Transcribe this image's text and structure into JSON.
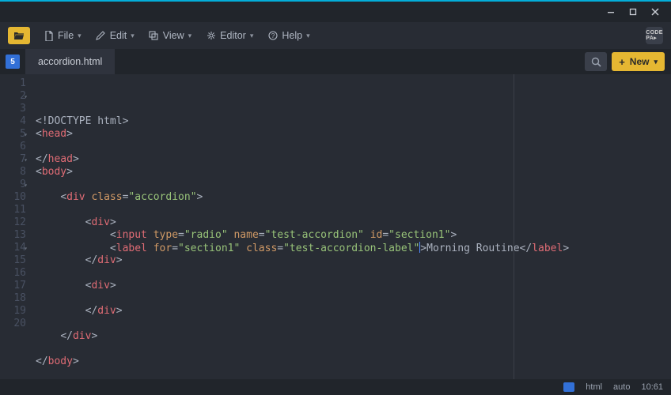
{
  "menu": {
    "file": "File",
    "edit": "Edit",
    "view": "View",
    "editor": "Editor",
    "help": "Help"
  },
  "tabs": {
    "active": "accordion.html",
    "new_label": "New"
  },
  "editor": {
    "lines": [
      {
        "n": 1,
        "fold": false,
        "tokens": [
          [
            "<!DOCTYPE html>",
            "t-doc"
          ]
        ]
      },
      {
        "n": 2,
        "fold": true,
        "tokens": [
          [
            "<",
            "t-punc"
          ],
          [
            "head",
            "t-tag"
          ],
          [
            ">",
            "t-punc"
          ]
        ]
      },
      {
        "n": 3,
        "fold": false,
        "tokens": []
      },
      {
        "n": 4,
        "fold": false,
        "tokens": [
          [
            "</",
            "t-punc"
          ],
          [
            "head",
            "t-tag"
          ],
          [
            ">",
            "t-punc"
          ]
        ]
      },
      {
        "n": 5,
        "fold": true,
        "tokens": [
          [
            "<",
            "t-punc"
          ],
          [
            "body",
            "t-tag"
          ],
          [
            ">",
            "t-punc"
          ]
        ]
      },
      {
        "n": 6,
        "fold": false,
        "tokens": []
      },
      {
        "n": 7,
        "fold": true,
        "tokens": [
          [
            "    ",
            "t-punc"
          ],
          [
            "<",
            "t-punc"
          ],
          [
            "div",
            "t-tag"
          ],
          [
            " ",
            "t-punc"
          ],
          [
            "class",
            "t-attr"
          ],
          [
            "=",
            "t-punc"
          ],
          [
            "\"accordion\"",
            "t-str"
          ],
          [
            ">",
            "t-punc"
          ]
        ]
      },
      {
        "n": 8,
        "fold": false,
        "tokens": []
      },
      {
        "n": 9,
        "fold": true,
        "tokens": [
          [
            "        ",
            "t-punc"
          ],
          [
            "<",
            "t-punc"
          ],
          [
            "div",
            "t-tag"
          ],
          [
            ">",
            "t-punc"
          ]
        ]
      },
      {
        "n": 10,
        "fold": false,
        "tokens": [
          [
            "            ",
            "t-punc"
          ],
          [
            "<",
            "t-punc"
          ],
          [
            "input",
            "t-tag"
          ],
          [
            " ",
            "t-punc"
          ],
          [
            "type",
            "t-attr"
          ],
          [
            "=",
            "t-punc"
          ],
          [
            "\"radio\"",
            "t-str"
          ],
          [
            " ",
            "t-punc"
          ],
          [
            "name",
            "t-attr"
          ],
          [
            "=",
            "t-punc"
          ],
          [
            "\"test-accordion\"",
            "t-str"
          ],
          [
            " ",
            "t-punc"
          ],
          [
            "id",
            "t-attr"
          ],
          [
            "=",
            "t-punc"
          ],
          [
            "\"section1\"",
            "t-str"
          ],
          [
            ">",
            "t-punc"
          ]
        ]
      },
      {
        "n": 11,
        "fold": false,
        "tokens": [
          [
            "            ",
            "t-punc"
          ],
          [
            "<",
            "t-punc"
          ],
          [
            "label",
            "t-tag"
          ],
          [
            " ",
            "t-punc"
          ],
          [
            "for",
            "t-attr"
          ],
          [
            "=",
            "t-punc"
          ],
          [
            "\"section1\"",
            "t-str"
          ],
          [
            " ",
            "t-punc"
          ],
          [
            "class",
            "t-attr"
          ],
          [
            "=",
            "t-punc"
          ],
          [
            "\"test-accordion-label\"",
            "t-str"
          ],
          [
            ">",
            "t-punc"
          ],
          [
            "Morning Routine",
            "t-txt"
          ],
          [
            "</",
            "t-punc"
          ],
          [
            "label",
            "t-tag"
          ],
          [
            ">",
            "t-punc"
          ]
        ],
        "cursor_after_token": 10
      },
      {
        "n": 12,
        "fold": false,
        "tokens": [
          [
            "        ",
            "t-punc"
          ],
          [
            "</",
            "t-punc"
          ],
          [
            "div",
            "t-tag"
          ],
          [
            ">",
            "t-punc"
          ]
        ]
      },
      {
        "n": 13,
        "fold": false,
        "tokens": []
      },
      {
        "n": 14,
        "fold": true,
        "tokens": [
          [
            "        ",
            "t-punc"
          ],
          [
            "<",
            "t-punc"
          ],
          [
            "div",
            "t-tag"
          ],
          [
            ">",
            "t-punc"
          ]
        ]
      },
      {
        "n": 15,
        "fold": false,
        "tokens": [
          [
            "        ",
            "t-punc"
          ]
        ]
      },
      {
        "n": 16,
        "fold": false,
        "tokens": [
          [
            "        ",
            "t-punc"
          ],
          [
            "</",
            "t-punc"
          ],
          [
            "div",
            "t-tag"
          ],
          [
            ">",
            "t-punc"
          ]
        ]
      },
      {
        "n": 17,
        "fold": false,
        "tokens": []
      },
      {
        "n": 18,
        "fold": false,
        "tokens": [
          [
            "    ",
            "t-punc"
          ],
          [
            "</",
            "t-punc"
          ],
          [
            "div",
            "t-tag"
          ],
          [
            ">",
            "t-punc"
          ]
        ]
      },
      {
        "n": 19,
        "fold": false,
        "tokens": []
      },
      {
        "n": 20,
        "fold": false,
        "tokens": [
          [
            "</",
            "t-punc"
          ],
          [
            "body",
            "t-tag"
          ],
          [
            ">",
            "t-punc"
          ]
        ]
      }
    ]
  },
  "status": {
    "lang": "html",
    "mode": "auto",
    "pos": "10:61"
  }
}
